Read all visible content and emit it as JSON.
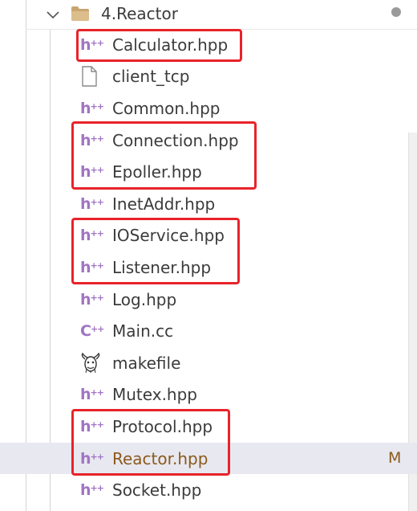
{
  "folder": {
    "name": "4.Reactor",
    "expanded": true,
    "icon": "folder-icon",
    "status_dot_color": "#9a9a9a"
  },
  "files": [
    {
      "name": "Calculator.hpp",
      "icon": "cpp-header-icon",
      "icon_text": "h",
      "icon_sup": "++",
      "highlighted": true
    },
    {
      "name": "client_tcp",
      "icon": "generic-file-icon",
      "highlighted": false
    },
    {
      "name": "Common.hpp",
      "icon": "cpp-header-icon",
      "icon_text": "h",
      "icon_sup": "++",
      "highlighted": false
    },
    {
      "name": "Connection.hpp",
      "icon": "cpp-header-icon",
      "icon_text": "h",
      "icon_sup": "++",
      "highlighted": true
    },
    {
      "name": "Epoller.hpp",
      "icon": "cpp-header-icon",
      "icon_text": "h",
      "icon_sup": "++",
      "highlighted": true
    },
    {
      "name": "InetAddr.hpp",
      "icon": "cpp-header-icon",
      "icon_text": "h",
      "icon_sup": "++",
      "highlighted": false
    },
    {
      "name": "IOService.hpp",
      "icon": "cpp-header-icon",
      "icon_text": "h",
      "icon_sup": "++",
      "highlighted": true
    },
    {
      "name": "Listener.hpp",
      "icon": "cpp-header-icon",
      "icon_text": "h",
      "icon_sup": "++",
      "highlighted": true
    },
    {
      "name": "Log.hpp",
      "icon": "cpp-header-icon",
      "icon_text": "h",
      "icon_sup": "++",
      "highlighted": false
    },
    {
      "name": "Main.cc",
      "icon": "cpp-source-icon",
      "icon_text": "C",
      "icon_sup": "++",
      "highlighted": false
    },
    {
      "name": "makefile",
      "icon": "gnu-makefile-icon",
      "highlighted": false
    },
    {
      "name": "Mutex.hpp",
      "icon": "cpp-header-icon",
      "icon_text": "h",
      "icon_sup": "++",
      "highlighted": false
    },
    {
      "name": "Protocol.hpp",
      "icon": "cpp-header-icon",
      "icon_text": "h",
      "icon_sup": "++",
      "highlighted": true
    },
    {
      "name": "Reactor.hpp",
      "icon": "cpp-header-icon",
      "icon_text": "h",
      "icon_sup": "++",
      "highlighted": true,
      "selected": true,
      "git_status": "M"
    },
    {
      "name": "Socket.hpp",
      "icon": "cpp-header-icon",
      "icon_text": "h",
      "icon_sup": "++",
      "highlighted": false
    }
  ],
  "colors": {
    "icon_purple": "#a074c4",
    "modified_text": "#8b5a1b",
    "highlight_red": "#e8232a",
    "selected_row": "#e8e8f0"
  }
}
